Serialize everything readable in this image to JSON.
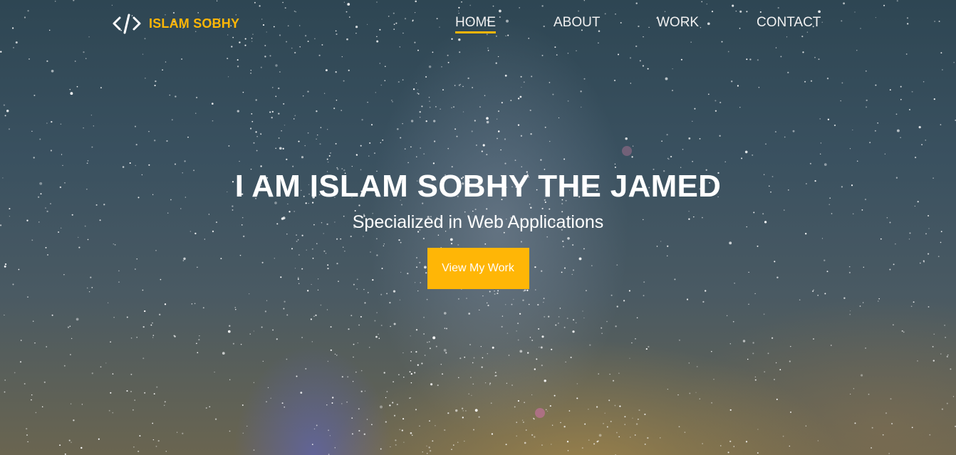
{
  "brand": {
    "name": "ISLAM SOBHY",
    "icon": "code-brackets-icon"
  },
  "nav": {
    "items": [
      {
        "label": "HOME",
        "active": true
      },
      {
        "label": "ABOUT",
        "active": false
      },
      {
        "label": "WORK",
        "active": false
      },
      {
        "label": "CONTACT",
        "active": false
      }
    ]
  },
  "hero": {
    "title": "I AM ISLAM SOBHY THE JAMED",
    "subtitle": "Specialized in Web Applications",
    "cta_label": "View My Work"
  },
  "colors": {
    "accent": "#ffb606",
    "text": "#ffffff"
  }
}
